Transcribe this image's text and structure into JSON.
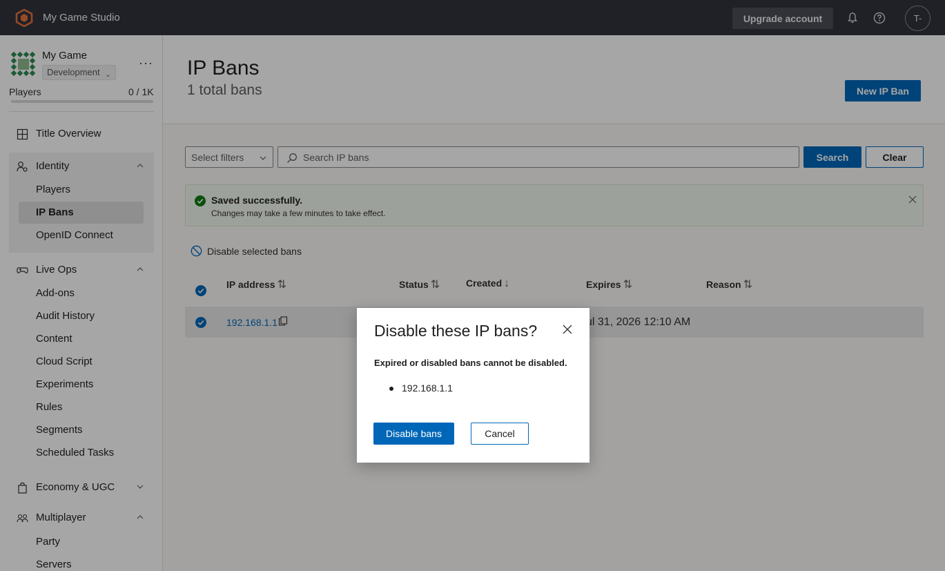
{
  "topbar": {
    "studio_name": "My Game Studio",
    "upgrade_label": "Upgrade account",
    "avatar_initials": "T-"
  },
  "sidebar": {
    "game_name": "My Game",
    "environment": "Development",
    "players_label": "Players",
    "players_value": "0 / 1K",
    "players_fraction": 0,
    "title_overview": "Title Overview",
    "identity": {
      "label": "Identity",
      "items": [
        "Players",
        "IP Bans",
        "OpenID Connect"
      ],
      "active": "IP Bans"
    },
    "liveops": {
      "label": "Live Ops",
      "items": [
        "Add-ons",
        "Audit History",
        "Content",
        "Cloud Script",
        "Experiments",
        "Rules",
        "Segments",
        "Scheduled Tasks"
      ]
    },
    "economy": {
      "label": "Economy & UGC"
    },
    "multiplayer": {
      "label": "Multiplayer",
      "items": [
        "Party",
        "Servers"
      ]
    }
  },
  "main": {
    "title": "IP Bans",
    "subtitle": "1 total bans",
    "new_button": "New IP Ban",
    "filter_placeholder": "Select filters",
    "search_placeholder": "Search IP bans",
    "search_button": "Search",
    "clear_button": "Clear",
    "banner": {
      "title": "Saved successfully.",
      "message": "Changes may take a few minutes to take effect."
    },
    "disable_selected": "Disable selected bans",
    "columns": [
      "IP address",
      "Status",
      "Created",
      "Expires",
      "Reason"
    ],
    "rows": [
      {
        "ip": "192.168.1.1",
        "expires": "ul 31, 2026 12:10 AM",
        "selected": true
      }
    ]
  },
  "dialog": {
    "title": "Disable these IP bans?",
    "message": "Expired or disabled bans cannot be disabled.",
    "items": [
      "192.168.1.1"
    ],
    "confirm_label": "Disable bans",
    "cancel_label": "Cancel"
  },
  "colors": {
    "accent": "#0067b8",
    "topbar": "#30343c",
    "success": "#107c10"
  }
}
